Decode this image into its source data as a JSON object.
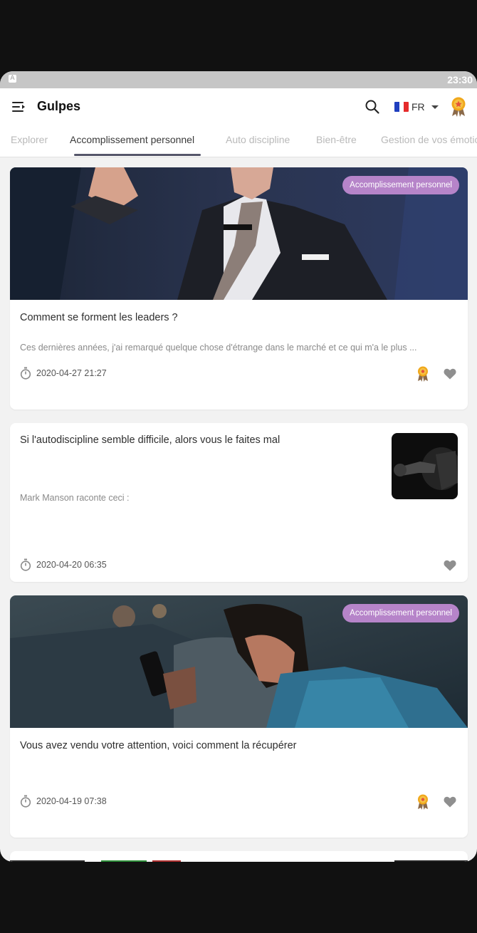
{
  "status_bar": {
    "time": "23:30",
    "notification_icon": "A"
  },
  "app_bar": {
    "title": "Gulpes",
    "language_code": "FR"
  },
  "tabs": [
    {
      "label": "Explorer",
      "active": false
    },
    {
      "label": "Accomplissement personnel",
      "active": true
    },
    {
      "label": "Auto discipline",
      "active": false
    },
    {
      "label": "Bien-être",
      "active": false
    },
    {
      "label": "Gestion de vos émotions",
      "active": false
    }
  ],
  "articles": [
    {
      "category": "Accomplissement personnel",
      "title": "Comment se forment les leaders ?",
      "excerpt": "Ces dernières années, j'ai remarqué quelque chose d'étrange dans le marché et ce qui m'a le plus ...",
      "date": "2020-04-27 21:27",
      "premium": true
    },
    {
      "title": "Si l'autodiscipline semble difficile, alors vous le faites mal",
      "excerpt": "Mark Manson raconte ceci :",
      "date": "2020-04-20 06:35",
      "premium": false
    },
    {
      "category": "Accomplissement personnel",
      "title": "Vous avez vendu votre attention, voici comment la récupérer",
      "date": "2020-04-19 07:38",
      "premium": true
    }
  ],
  "colors": {
    "category_pill": "#b684c9",
    "active_tab_indicator": "#55566a",
    "award_gold": "#f0a81c",
    "heart": "#8f8f8f"
  }
}
